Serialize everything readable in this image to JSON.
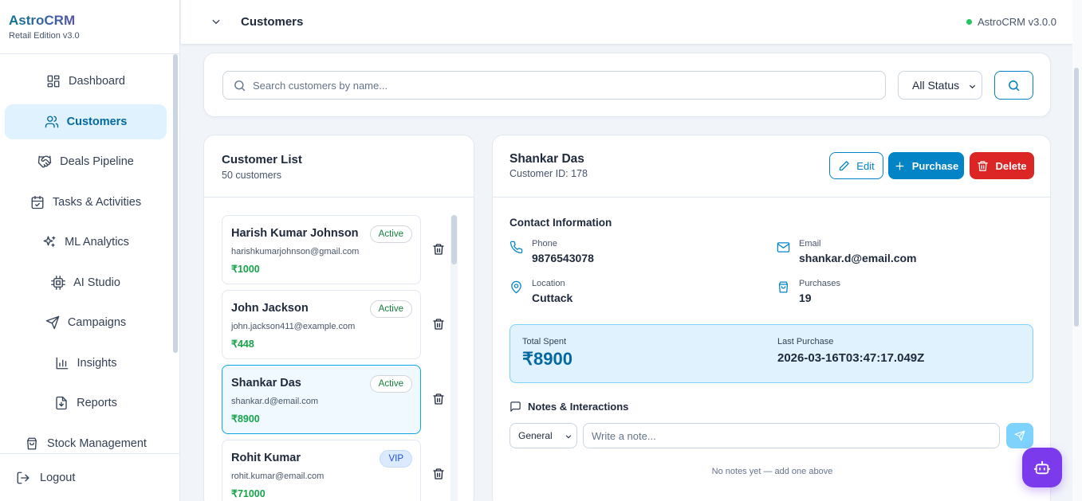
{
  "brand": {
    "title": "AstroCRM",
    "subtitle": "Retail Edition v3.0"
  },
  "sidebar": {
    "items": [
      {
        "label": "Dashboard",
        "icon": "dashboard-icon",
        "active": false
      },
      {
        "label": "Customers",
        "icon": "users-icon",
        "active": true
      },
      {
        "label": "Deals Pipeline",
        "icon": "handshake-icon",
        "active": false
      },
      {
        "label": "Tasks & Activities",
        "icon": "calendar-check-icon",
        "active": false
      },
      {
        "label": "ML Analytics",
        "icon": "sparkles-icon",
        "active": false
      },
      {
        "label": "AI Studio",
        "icon": "cpu-icon",
        "active": false
      },
      {
        "label": "Campaigns",
        "icon": "send-icon",
        "active": false
      },
      {
        "label": "Insights",
        "icon": "bar-chart-icon",
        "active": false
      },
      {
        "label": "Reports",
        "icon": "file-download-icon",
        "active": false
      },
      {
        "label": "Stock Management",
        "icon": "shopping-bag-icon",
        "active": false
      }
    ],
    "logout": "Logout"
  },
  "header": {
    "title": "Customers",
    "version": "AstroCRM v3.0.0",
    "status_color": "#22c55e"
  },
  "search": {
    "placeholder": "Search customers by name...",
    "value": "",
    "status_filter": "All Status"
  },
  "customer_list": {
    "title": "Customer List",
    "count": "50 customers",
    "customers": [
      {
        "name": "Harish Kumar Johnson",
        "email": "harishkumarjohnson@gmail.com",
        "amount": "₹1000",
        "status": "Active",
        "selected": false
      },
      {
        "name": "John Jackson",
        "email": "john.jackson411@example.com",
        "amount": "₹448",
        "status": "Active",
        "selected": false
      },
      {
        "name": "Shankar Das",
        "email": "shankar.d@email.com",
        "amount": "₹8900",
        "status": "Active",
        "selected": true
      },
      {
        "name": "Rohit Kumar",
        "email": "rohit.kumar@email.com",
        "amount": "₹71000",
        "status": "VIP",
        "selected": false
      }
    ]
  },
  "detail": {
    "name": "Shankar Das",
    "customer_id": "Customer ID: 178",
    "buttons": {
      "edit": "Edit",
      "purchase": "Purchase",
      "delete": "Delete"
    },
    "contact_title": "Contact Information",
    "phone_label": "Phone",
    "phone": "9876543078",
    "email_label": "Email",
    "email": "shankar.d@email.com",
    "location_label": "Location",
    "location": "Cuttack",
    "purchases_label": "Purchases",
    "purchases": "19",
    "total_spent_label": "Total Spent",
    "total_spent": "₹8900",
    "last_purchase_label": "Last Purchase",
    "last_purchase": "2026-03-16T03:47:17.049Z",
    "notes_title": "Notes & Interactions",
    "note_type": "General",
    "note_placeholder": "Write a note...",
    "notes_empty": "No notes yet — add one above"
  },
  "colors": {
    "accent": "#0284c7",
    "danger": "#dc2626",
    "success": "#16a34a",
    "assistant": "#7c3aed"
  }
}
